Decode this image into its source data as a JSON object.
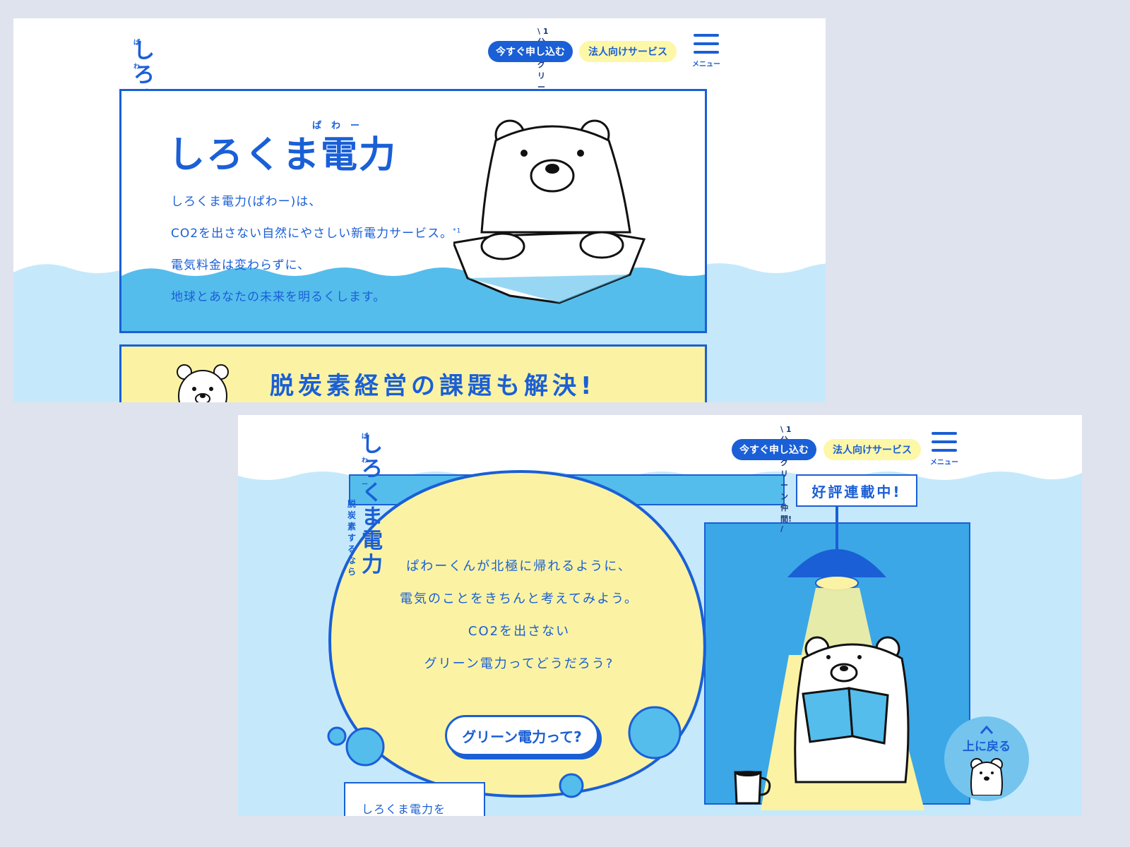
{
  "header": {
    "logo_sub_line1": "脱炭素",
    "logo_sub_line2": "するなら",
    "logo_main": "しろくま電力",
    "logo_ruby": "ぱわー",
    "tagline": "\\ 1分でグリーン仲間! /",
    "apply_button": "今すぐ申し込む",
    "business_button": "法人向けサービス",
    "menu_label": "メニュー"
  },
  "hero": {
    "title": "しろくま電力",
    "title_ruby": "ぱわー",
    "lines": [
      "しろくま電力(ぱわー)は、",
      "CO2を出さない自然にやさしい新電力サービス。",
      "電気料金は変わらずに、",
      "地球とあなたの未来を明るくします。"
    ],
    "footnote": "*1"
  },
  "promo": {
    "text": "脱炭素経営の課題も解決!"
  },
  "story": {
    "lines": [
      "ぱわーくんが北極に帰れるように、",
      "電気のことをきちんと考えてみよう。",
      "CO2を出さない",
      "グリーン電力ってどうだろう?"
    ],
    "cta": "グリーン電力って?",
    "series_badge": "好評連載中!",
    "back_to_top": "上に戻る",
    "bottom_snippet": "しろくま電力を"
  },
  "colors": {
    "brand_blue": "#1a5fd6",
    "sea_blue": "#54bdec",
    "light_sea": "#c5e9fb",
    "pale_yellow": "#fbf3a3"
  }
}
